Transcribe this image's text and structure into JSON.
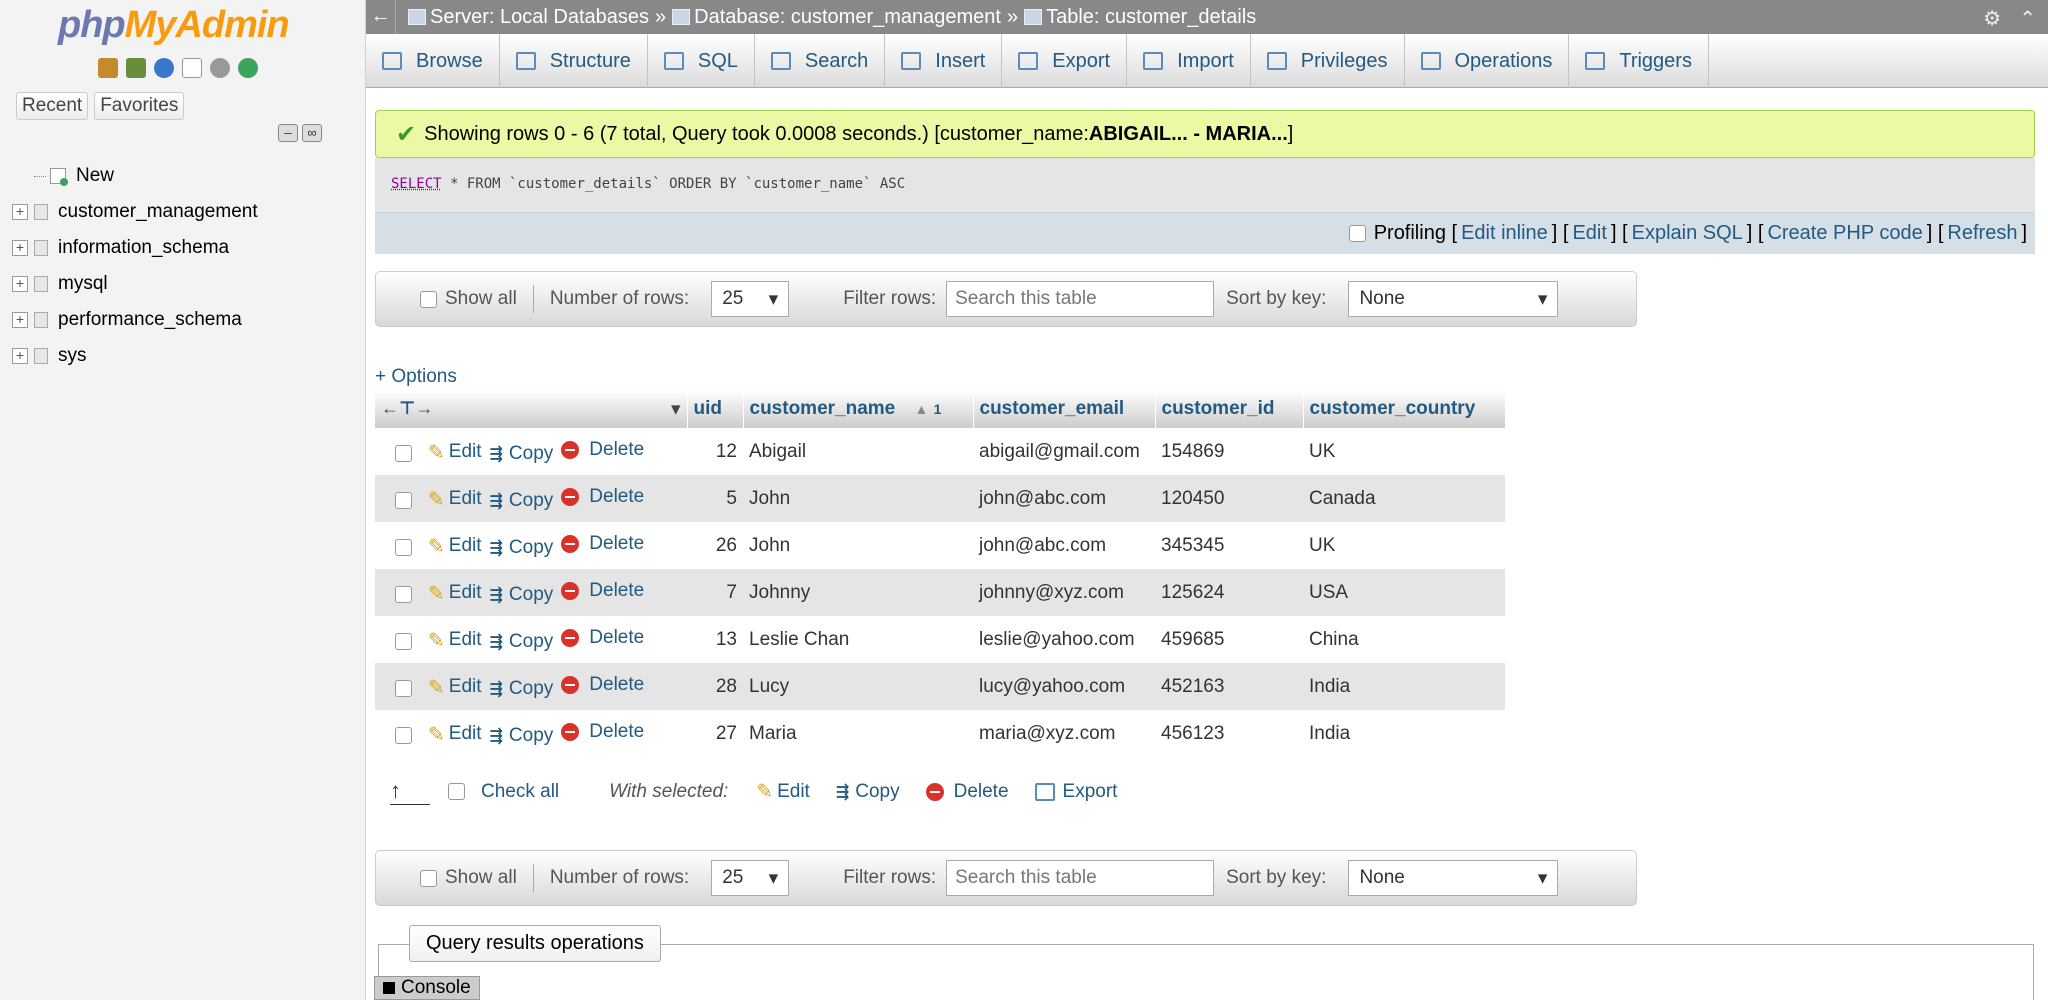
{
  "sidebar": {
    "logo_php": "php",
    "logo_myadmin": "MyAdmin",
    "tabs": [
      "Recent",
      "Favorites"
    ],
    "new_label": "New",
    "databases": [
      "customer_management",
      "information_schema",
      "mysql",
      "performance_schema",
      "sys"
    ]
  },
  "topbar": {
    "server": "Server: Local Databases",
    "database": "Database: customer_management",
    "table": "Table: customer_details",
    "separator": "»"
  },
  "menu": [
    "Browse",
    "Structure",
    "SQL",
    "Search",
    "Insert",
    "Export",
    "Import",
    "Privileges",
    "Operations",
    "Triggers"
  ],
  "success": {
    "text": "Showing rows 0 - 6 (7 total, Query took 0.0008 seconds.) [customer_name: ",
    "range": "ABIGAIL... - MARIA...",
    "end": "]"
  },
  "sql": {
    "keyword": "SELECT",
    "rest": " * FROM `customer_details` ORDER BY `customer_name` ASC"
  },
  "profiling": {
    "label": "Profiling",
    "links": [
      "Edit inline",
      "Edit",
      "Explain SQL",
      "Create PHP code",
      "Refresh"
    ]
  },
  "navbar": {
    "show_all": "Show all",
    "num_rows_label": "Number of rows:",
    "num_rows_value": "25",
    "filter_label": "Filter rows:",
    "filter_placeholder": "Search this table",
    "sort_label": "Sort by key:",
    "sort_value": "None"
  },
  "options_label": "+ Options",
  "table": {
    "columns": [
      "uid",
      "customer_name",
      "customer_email",
      "customer_id",
      "customer_country"
    ],
    "sort_indicator": "1",
    "actions": [
      "Edit",
      "Copy",
      "Delete"
    ],
    "rows": [
      {
        "uid": "12",
        "name": "Abigail",
        "email": "abigail@gmail.com",
        "cid": "154869",
        "country": "UK"
      },
      {
        "uid": "5",
        "name": "John",
        "email": "john@abc.com",
        "cid": "120450",
        "country": "Canada"
      },
      {
        "uid": "26",
        "name": "John",
        "email": "john@abc.com",
        "cid": "345345",
        "country": "UK"
      },
      {
        "uid": "7",
        "name": "Johnny",
        "email": "johnny@xyz.com",
        "cid": "125624",
        "country": "USA"
      },
      {
        "uid": "13",
        "name": "Leslie Chan",
        "email": "leslie@yahoo.com",
        "cid": "459685",
        "country": "China"
      },
      {
        "uid": "28",
        "name": "Lucy",
        "email": "lucy@yahoo.com",
        "cid": "452163",
        "country": "India"
      },
      {
        "uid": "27",
        "name": "Maria",
        "email": "maria@xyz.com",
        "cid": "456123",
        "country": "India"
      }
    ]
  },
  "bulk": {
    "check_all": "Check all",
    "with_selected": "With selected:",
    "edit": "Edit",
    "copy": "Copy",
    "delete": "Delete",
    "export": "Export"
  },
  "query_ops_label": "Query results operations",
  "console_label": "Console"
}
